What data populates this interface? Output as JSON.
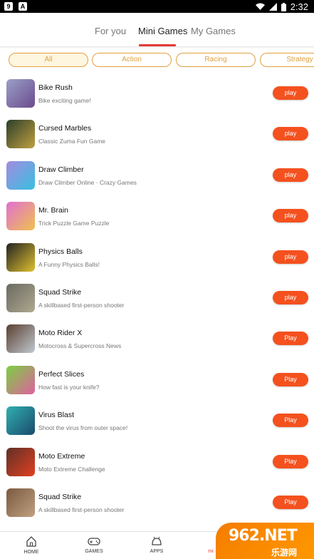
{
  "status_bar": {
    "time": "2:32",
    "left_icons": [
      "app-notification-icon",
      "a-notification-icon"
    ],
    "right_icons": [
      "wifi-icon",
      "signal-icon",
      "battery-icon"
    ]
  },
  "top_tabs": [
    {
      "label": "For you",
      "active": false
    },
    {
      "label": "Mini Games",
      "active": true
    },
    {
      "label": "My Games",
      "active": false
    }
  ],
  "filters": [
    "All",
    "Action",
    "Racing",
    "Strategy"
  ],
  "games": [
    {
      "title": "Bike Rush",
      "subtitle": "Bike exciting game!",
      "button": "play",
      "thumb_colors": [
        "#9aa0c8",
        "#6b4a8c"
      ]
    },
    {
      "title": "Cursed Marbles",
      "subtitle": "Classic Zuma Fun Game",
      "button": "play",
      "thumb_colors": [
        "#2c3e2a",
        "#c0a040"
      ]
    },
    {
      "title": "Draw Climber",
      "subtitle": "Draw Climber Online · Crazy Games",
      "button": "play",
      "thumb_colors": [
        "#a58be0",
        "#35c0e0"
      ]
    },
    {
      "title": "Mr. Brain",
      "subtitle": "Trick Puzzle Game    Puzzle",
      "button": "play",
      "thumb_colors": [
        "#e070d0",
        "#f0c050"
      ]
    },
    {
      "title": "Physics Balls",
      "subtitle": "A Funny Physics Balls!",
      "button": "play",
      "thumb_colors": [
        "#222222",
        "#e0c030"
      ]
    },
    {
      "title": "Squad Strike",
      "subtitle": "A skillbased first-person shooter",
      "button": "play",
      "thumb_colors": [
        "#6a6a60",
        "#b0a890"
      ]
    },
    {
      "title": "Moto Rider X",
      "subtitle": "Motocross & Supercross News",
      "button": "Play",
      "thumb_colors": [
        "#5a4030",
        "#c0c8d0"
      ]
    },
    {
      "title": "Perfect Slices",
      "subtitle": "How fast is your knife?",
      "button": "Play",
      "thumb_colors": [
        "#7ad040",
        "#e060a0"
      ]
    },
    {
      "title": "Virus Blast",
      "subtitle": "Shoot the virus from outer space!",
      "button": "Play",
      "thumb_colors": [
        "#30b0b0",
        "#1a4a6a"
      ]
    },
    {
      "title": "Moto Extreme",
      "subtitle": "Moto Extreme Challenge",
      "button": "Play",
      "thumb_colors": [
        "#603028",
        "#e04020"
      ]
    },
    {
      "title": "Squad Strike",
      "subtitle": "A skillbased first-person shooter",
      "button": "Play",
      "thumb_colors": [
        "#7a5a40",
        "#c0a080"
      ]
    }
  ],
  "bottom_nav": [
    {
      "label": "HOME",
      "icon": "home-icon"
    },
    {
      "label": "GAMES",
      "icon": "gamepad-icon"
    },
    {
      "label": "APPS",
      "icon": "android-icon"
    },
    {
      "label": "mi",
      "icon": "mini-icon"
    }
  ],
  "watermark": {
    "text": "962.NET",
    "sub": "乐游网"
  },
  "colors": {
    "accent": "#e53935",
    "play": "#f4511e",
    "chip": "#e0a040"
  }
}
